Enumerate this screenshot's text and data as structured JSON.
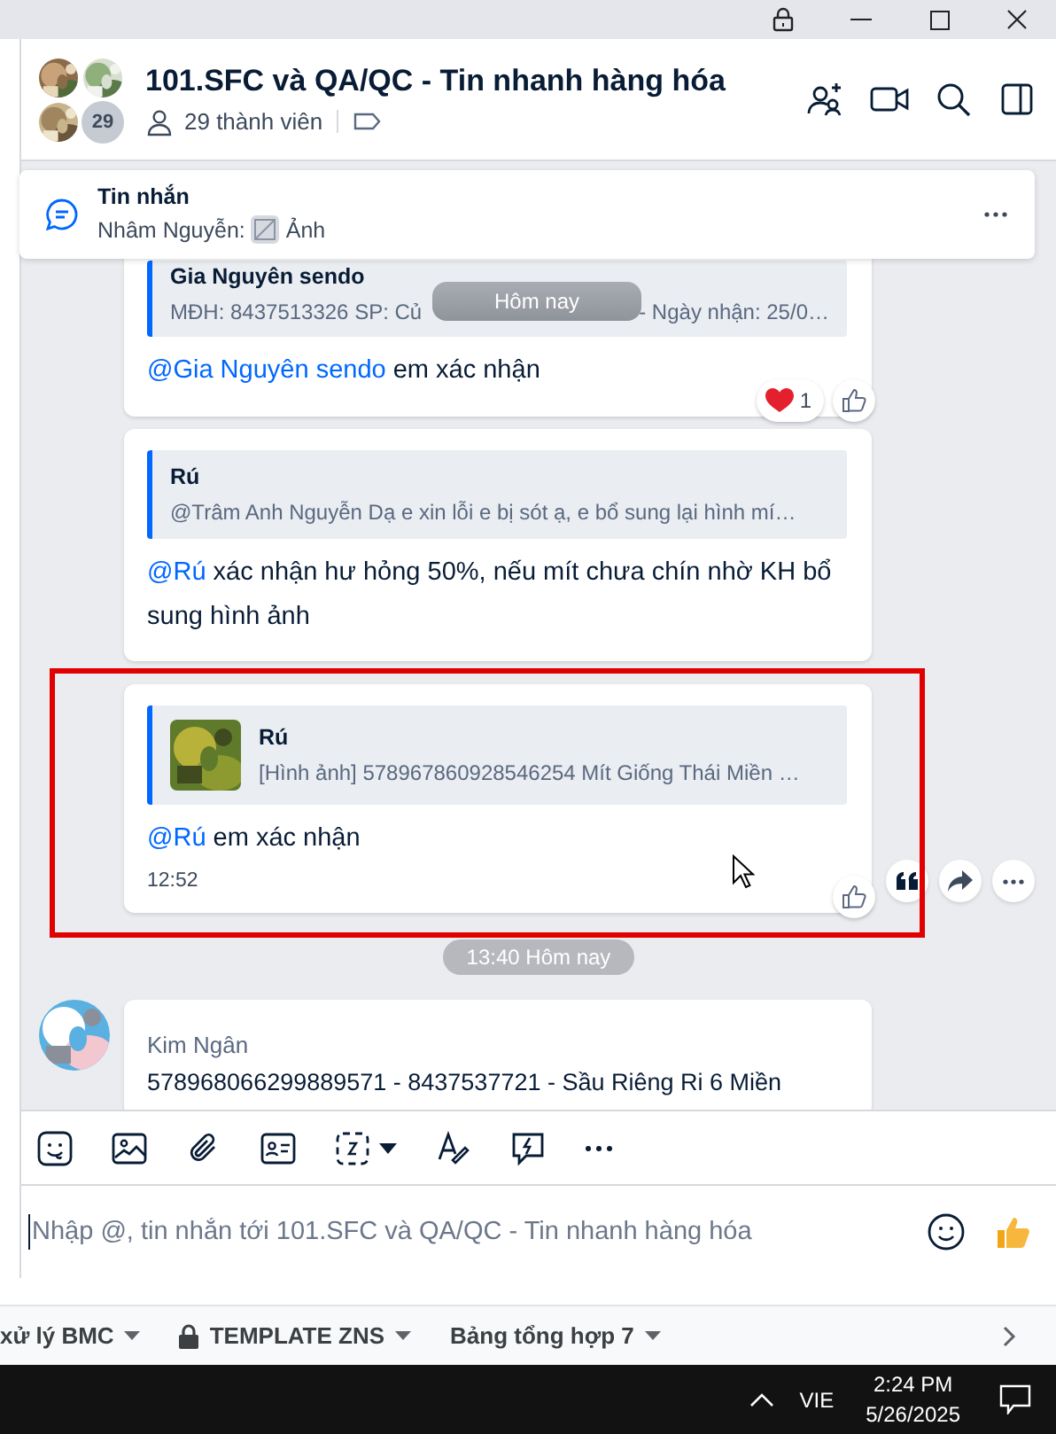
{
  "header": {
    "title": "101.SFC và QA/QC - Tin nhanh hàng hóa",
    "avatars": [
      {
        "kind": "picture"
      },
      {
        "kind": "picture"
      },
      {
        "kind": "picture"
      }
    ],
    "avatar_count": "29",
    "members": "29 thành viên"
  },
  "pinned": {
    "title": "Tin nhắn",
    "sender": "Nhâm Nguyễn:",
    "preview": "Ảnh"
  },
  "floating_date": "Hôm nay",
  "feed": [
    {
      "kind": "message",
      "quote_author": "Gia Nguyên sendo",
      "quote_text": [
        "MĐH: 8437513326 SP: Củ",
        "- Ngày nhận: 25/0…"
      ],
      "mention": "@Gia Nguyên sendo",
      "text": "em xác nhận",
      "reaction_count": "1",
      "like_button": true,
      "highlighted": false,
      "hovered": false
    },
    {
      "kind": "message",
      "quote_author": "Rú",
      "quote_text": [
        "@Trâm Anh Nguyễn Dạ e xin lỗi e bị sót ạ, e bổ sung lại hình mí…"
      ],
      "mention": "@Rú",
      "text": "xác nhận hư hỏng 50%, nếu mít chưa chín nhờ KH bổ sung hình ảnh",
      "like_button": false,
      "highlighted": false,
      "hovered": false
    },
    {
      "kind": "message",
      "quote_author": "Rú",
      "quote_thumbnail": {
        "kind": "picture"
      },
      "quote_text": [
        "[Hình ảnh] 578967860928546254 Mít Giống Thái Miền …"
      ],
      "mention": "@Rú",
      "text": "em xác nhận",
      "time": "12:52",
      "like_button": true,
      "highlighted": true,
      "hovered": true
    },
    {
      "kind": "divider",
      "label": "13:40 Hôm nay"
    },
    {
      "kind": "message",
      "avatar": {
        "kind": "picture"
      },
      "sender": "Kim Ngân",
      "text": "578968066299889571 - 8437537721 - Sầu Riêng Ri 6 Miền",
      "like_button": false,
      "highlighted": false,
      "hovered": false
    }
  ],
  "composer": {
    "placeholder": "Nhập @, tin nhắn tới 101.SFC và QA/QC - Tin nhanh hàng hóa"
  },
  "sheet_tabs": [
    {
      "label": "xử lý BMC",
      "locked": false
    },
    {
      "label": "TEMPLATE ZNS",
      "locked": true
    },
    {
      "label": "Bảng tổng hợp 7",
      "locked": false
    }
  ],
  "taskbar": {
    "language": "VIE",
    "time": "2:24 PM",
    "date": "5/26/2025"
  }
}
